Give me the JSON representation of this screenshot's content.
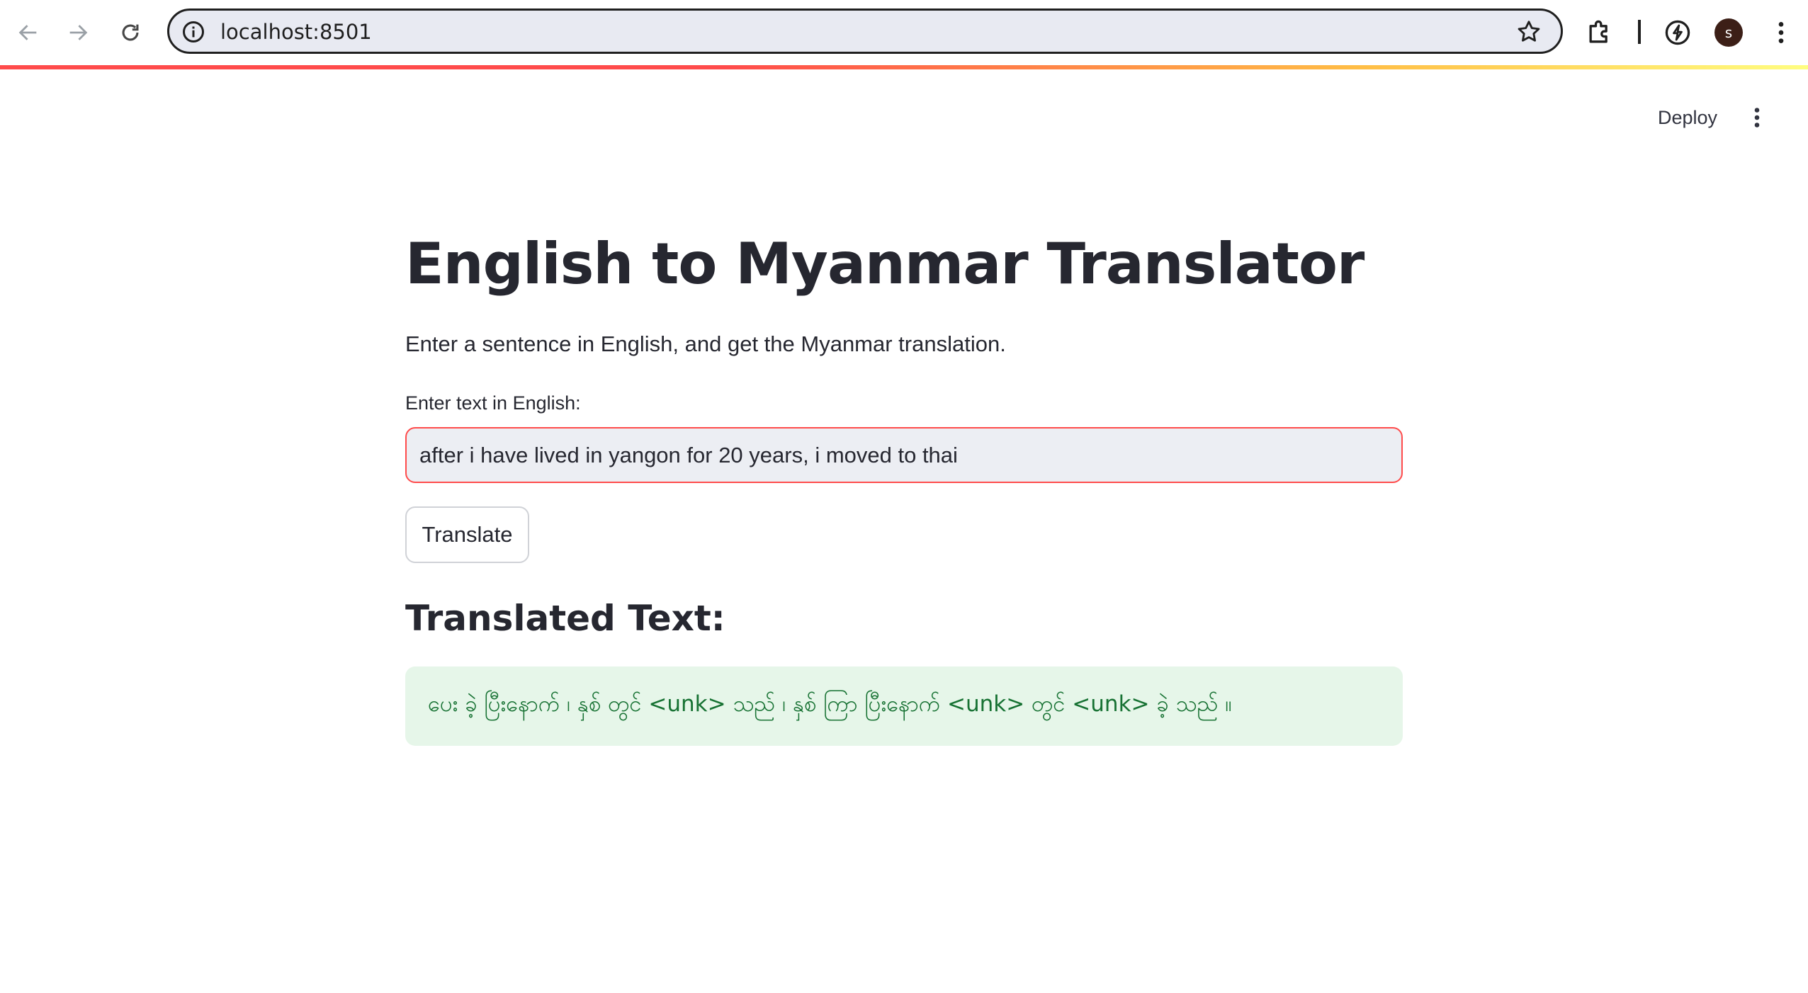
{
  "browser": {
    "url": "localhost:8501",
    "profile_initial": "s",
    "icons": {
      "back": "back-arrow-icon",
      "forward": "forward-arrow-icon",
      "reload": "reload-icon",
      "site_info": "info-icon",
      "bookmark": "star-icon",
      "extensions": "puzzle-icon",
      "performance": "speed-icon",
      "menu": "kebab-menu-icon"
    }
  },
  "app_header": {
    "deploy_label": "Deploy",
    "menu_icon": "kebab-menu-icon",
    "decoration_colors": [
      "#ff4b4b",
      "#ffbd45",
      "#fffd80"
    ]
  },
  "main": {
    "title": "English to Myanmar Translator",
    "subtitle": "Enter a sentence in English, and get the Myanmar translation.",
    "input": {
      "label": "Enter text in English:",
      "value": "after i have lived in yangon for 20 years, i moved to thai"
    },
    "translate_button": "Translate",
    "result_heading": "Translated Text:",
    "result_text": "ပေး ခဲ့ ပြီးနောက် ၊ နှစ် တွင် <unk> သည် ၊ နှစ် ကြာ ပြီးနောက် <unk> တွင် <unk> ခဲ့ သည် ။"
  },
  "colors": {
    "accent": "#ff4b4b",
    "success_bg": "#e6f6e9",
    "success_text": "#177233"
  }
}
